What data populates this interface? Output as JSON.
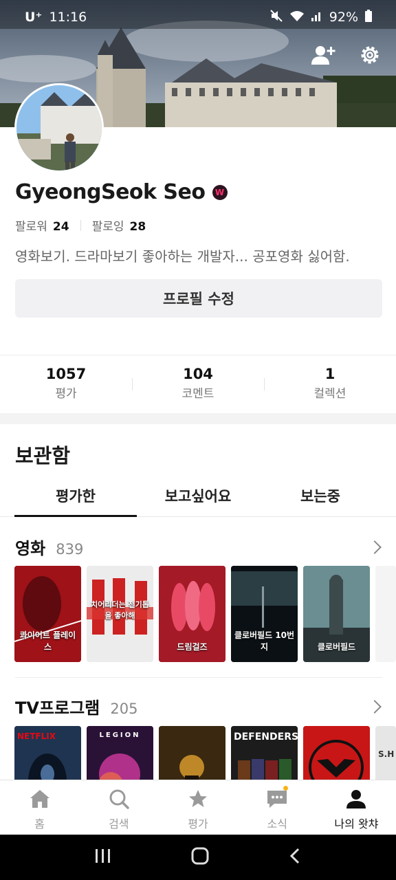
{
  "status_bar": {
    "carrier": "U⁺",
    "time": "11:16",
    "battery": "92%"
  },
  "profile": {
    "name": "GyeongSeok Seo",
    "badge": "W",
    "followers_label": "팔로워",
    "followers_count": "24",
    "following_label": "팔로잉",
    "following_count": "28",
    "bio": "영화보기. 드라마보기 좋아하는 개발자... 공포영화 싫어함.",
    "edit_button": "프로필 수정"
  },
  "stats": [
    {
      "value": "1057",
      "label": "평가"
    },
    {
      "value": "104",
      "label": "코멘트"
    },
    {
      "value": "1",
      "label": "컬렉션"
    }
  ],
  "archive": {
    "title": "보관함",
    "tabs": [
      "평가한",
      "보고싶어요",
      "보는중"
    ]
  },
  "sections": {
    "movies": {
      "title": "영화",
      "count": "839",
      "posters": [
        {
          "text": "콰이어트 플레이스",
          "color": "#b3151b"
        },
        {
          "text": "치어리더는 전기톱을 좋아해",
          "color": "#e8e8e8"
        },
        {
          "text": "드림걸즈",
          "color": "#8e1822"
        },
        {
          "text": "클로버필드 10번지",
          "color": "#0c1115"
        },
        {
          "text": "클로버필드",
          "color": "#5b7d80"
        },
        {
          "text": "",
          "color": "#f4f4f4"
        }
      ]
    },
    "tv": {
      "title": "TV프로그램",
      "count": "205",
      "posters": [
        {
          "text": "NETFLIX",
          "color": "#1c2a3d"
        },
        {
          "text": "LEGION",
          "color": "#2a1432"
        },
        {
          "text": "",
          "color": "#3b2a12"
        },
        {
          "text": "DEFENDERS",
          "color": "#1b1b1b"
        },
        {
          "text": "",
          "color": "#c81616"
        },
        {
          "text": "S.H",
          "color": "#e6e6e6"
        }
      ]
    }
  },
  "bottom_nav": [
    {
      "label": "홈",
      "icon": "home-icon"
    },
    {
      "label": "검색",
      "icon": "search-icon"
    },
    {
      "label": "평가",
      "icon": "star-icon"
    },
    {
      "label": "소식",
      "icon": "news-icon"
    },
    {
      "label": "나의 왓챠",
      "icon": "profile-icon"
    }
  ],
  "colors": {
    "accent": "#f6b41a",
    "badge": "#ff2f6e"
  }
}
